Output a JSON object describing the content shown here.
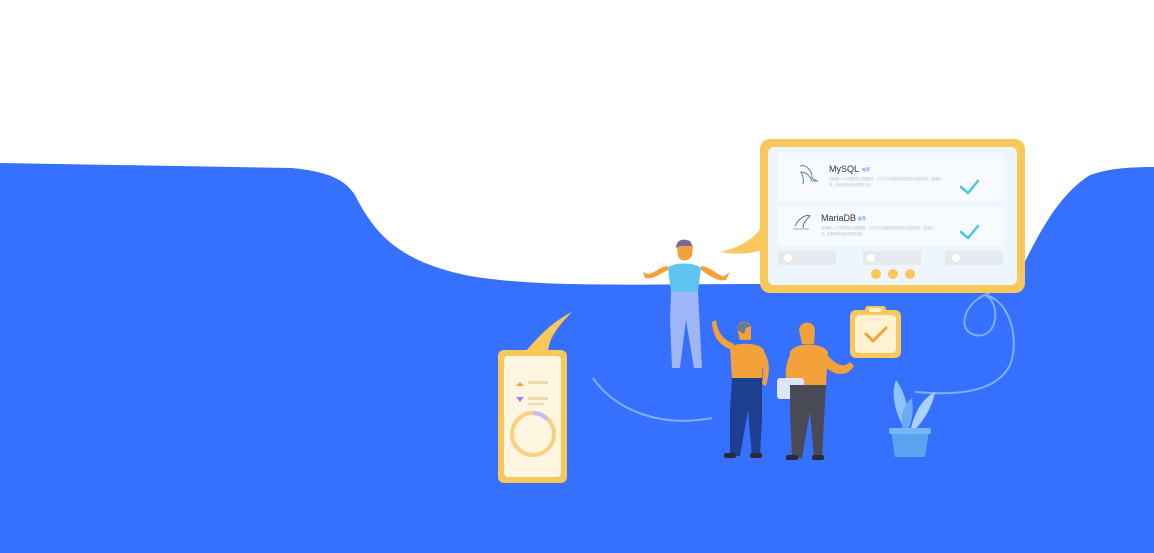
{
  "colors": {
    "background": "#ffffff",
    "wave_blue": "#3570FF",
    "frame_yellow": "#F8C85A",
    "panel_white": "#F4F9FF",
    "check_teal": "#4FC3E8",
    "figure_orange": "#F3A23B",
    "figure_navy": "#1E3E8F",
    "figure_gray": "#4A4A55",
    "plant_blue": "#5BA4F0"
  },
  "board": {
    "cards": [
      {
        "name": "MySQL",
        "tag": "推荐",
        "desc_line1": "请按输入以下配置项以创建服务，点击下方连接测试按钮进行连接检测。支持版",
        "desc_line2": "本，配置说明请参阅说明文档",
        "icon": "mysql-dolphin-icon"
      },
      {
        "name": "MariaDB",
        "tag": "推荐",
        "desc_line1": "请按输入以下配置项以创建服务，点击下方连接测试按钮进行连接检测。支持版",
        "desc_line2": "本，配置说明请参阅说明文档",
        "icon": "mariadb-seal-icon"
      }
    ]
  },
  "icons": {
    "check": "check-icon",
    "clipboard": "clipboard-check-icon",
    "plant": "potted-plant-icon",
    "phone": "phone-icon"
  }
}
